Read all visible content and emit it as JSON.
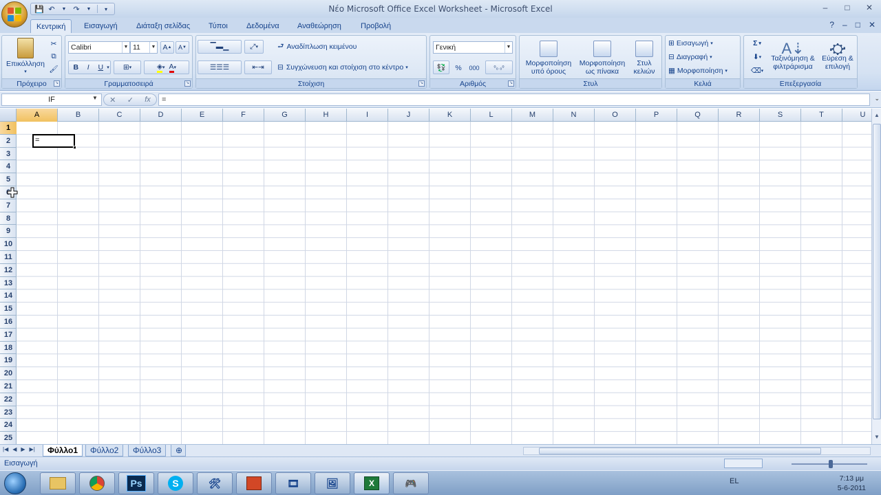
{
  "window": {
    "title": "Νέο Microsoft Office Excel Worksheet - Microsoft Excel",
    "minimize": "–",
    "maximize": "□",
    "close": "✕"
  },
  "ribbon_tabs": [
    {
      "label": "Κεντρική",
      "active": true
    },
    {
      "label": "Εισαγωγή",
      "active": false
    },
    {
      "label": "Διάταξη σελίδας",
      "active": false
    },
    {
      "label": "Τύποι",
      "active": false
    },
    {
      "label": "Δεδομένα",
      "active": false
    },
    {
      "label": "Αναθεώρηση",
      "active": false
    },
    {
      "label": "Προβολή",
      "active": false
    }
  ],
  "groups": {
    "clipboard": {
      "label": "Πρόχειρο",
      "paste": "Επικόλληση"
    },
    "font": {
      "label": "Γραμματοσειρά",
      "font_name": "Calibri",
      "font_size": "11",
      "bold": "B",
      "italic": "I",
      "underline": "U"
    },
    "alignment": {
      "label": "Στοίχιση",
      "wrap_text": "Αναδίπλωση κειμένου",
      "merge_center": "Συγχώνευση και στοίχιση στο κέντρο"
    },
    "number": {
      "label": "Αριθμός",
      "format": "Γενική",
      "percent": "%",
      "thousands": "000"
    },
    "styles": {
      "label": "Στυλ",
      "conditional": "Μορφοποίηση υπό όρους",
      "as_table": "Μορφοποίηση ως πίνακα",
      "cell_styles": "Στυλ κελιών"
    },
    "cells": {
      "label": "Κελιά",
      "insert": "Εισαγωγή",
      "delete": "Διαγραφή",
      "format": "Μορφοποίηση"
    },
    "editing": {
      "label": "Επεξεργασία",
      "sum": "Σ",
      "sort_filter": "Ταξινόμηση & φιλτράρισμα",
      "find_select": "Εύρεση & επιλογή"
    }
  },
  "formula_bar": {
    "name_box": "IF",
    "cancel": "✕",
    "enter": "✓",
    "fx": "fx",
    "formula": "="
  },
  "sheet": {
    "columns": [
      "A",
      "B",
      "C",
      "D",
      "E",
      "F",
      "G",
      "H",
      "I",
      "J",
      "K",
      "L",
      "M",
      "N",
      "O",
      "P",
      "Q",
      "R",
      "S",
      "T",
      "U"
    ],
    "rows": [
      "1",
      "2",
      "3",
      "4",
      "5",
      "6",
      "7",
      "8",
      "9",
      "10",
      "11",
      "12",
      "13",
      "14",
      "15",
      "16",
      "17",
      "18",
      "19",
      "20",
      "21",
      "22",
      "23",
      "24",
      "25"
    ],
    "active_cell_value": "="
  },
  "sheet_tabs": [
    {
      "label": "Φύλλο1",
      "active": true
    },
    {
      "label": "Φύλλο2",
      "active": false
    },
    {
      "label": "Φύλλο3",
      "active": false
    }
  ],
  "status": {
    "mode": "Εισαγωγή"
  },
  "taskbar": {
    "apps": [
      "explorer",
      "chrome",
      "Ps",
      "S",
      "tool",
      "powerpoint",
      "media",
      "picture",
      "excel",
      "unknown"
    ],
    "language": "EL",
    "time": "7:13 μμ",
    "date": "5-6-2011"
  }
}
